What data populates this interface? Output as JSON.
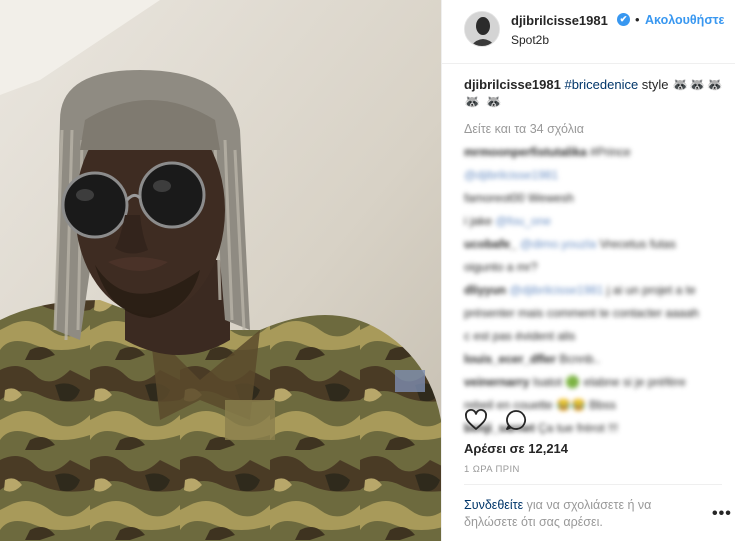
{
  "post": {
    "username": "djibrilcisse1981",
    "verified_mark": "✔",
    "separator": "•",
    "follow_label": "Ακολουθήστε",
    "location": "Spot2b",
    "caption": {
      "username": "djibrilcisse1981",
      "hashtag": "#bricedenice",
      "text": " style ",
      "emojis": "🦝🦝🦝🦝 🦝"
    },
    "load_more_label": "Δείτε και τα 34 σχόλια",
    "comments": [
      {
        "user": "mrmoonperfistutalika",
        "text": "#Prince",
        "mention": "",
        "extra": ""
      },
      {
        "user": "",
        "text": "",
        "mention": "@djibrilcisse1981",
        "extra": ""
      },
      {
        "user": "",
        "text": "famoreot00 Wewesh",
        "mention": "",
        "extra": ""
      },
      {
        "user": "",
        "text": "i jake ",
        "mention": "@fou_one",
        "extra": ""
      },
      {
        "user": "ucobafe_",
        "text": "",
        "mention": "@dimo.youzla",
        "extra": " Vrecetus futas"
      },
      {
        "user": "",
        "text": "oigunto a mr?",
        "mention": "",
        "extra": ""
      },
      {
        "user": "dliyyun",
        "text": "",
        "mention": "@djibrilcisse1981",
        "extra": " j ai un projet a te"
      },
      {
        "user": "",
        "text": "présenter mais comment te contacter aaaah",
        "mention": "",
        "extra": ""
      },
      {
        "user": "",
        "text": "c est pas évident alis",
        "mention": "",
        "extra": ""
      },
      {
        "user": "louis_ecer_dfler",
        "text": "Bcnnb..",
        "mention": "",
        "extra": ""
      },
      {
        "user": "veinernarry",
        "text": "Isatot 🟢 elabne si je préfère",
        "mention": "",
        "extra": ""
      },
      {
        "user": "",
        "text": "rebeil en couette 😂😂 Bbss",
        "mention": "",
        "extra": ""
      },
      {
        "user": "benji_sarnet",
        "text": "Ça tue frérot !!!",
        "mention": "",
        "extra": ""
      }
    ],
    "likes_label": "Αρέσει σε 12,214",
    "time_label": "1 ΩΡΑ ΠΡΙΝ",
    "login_link": "Συνδεθείτε",
    "login_text": " για να σχολιάσετε ή να δηλώσετε ότι σας αρέσει.",
    "more_label": "•••"
  },
  "icons": {
    "like": "heart-icon",
    "comment": "comment-bubble-icon",
    "more": "ellipsis-icon",
    "verified": "verified-badge-icon"
  },
  "colors": {
    "link": "#003569",
    "follow": "#3897f0",
    "muted": "#999999",
    "text": "#262626",
    "verified": "#3897f0"
  }
}
